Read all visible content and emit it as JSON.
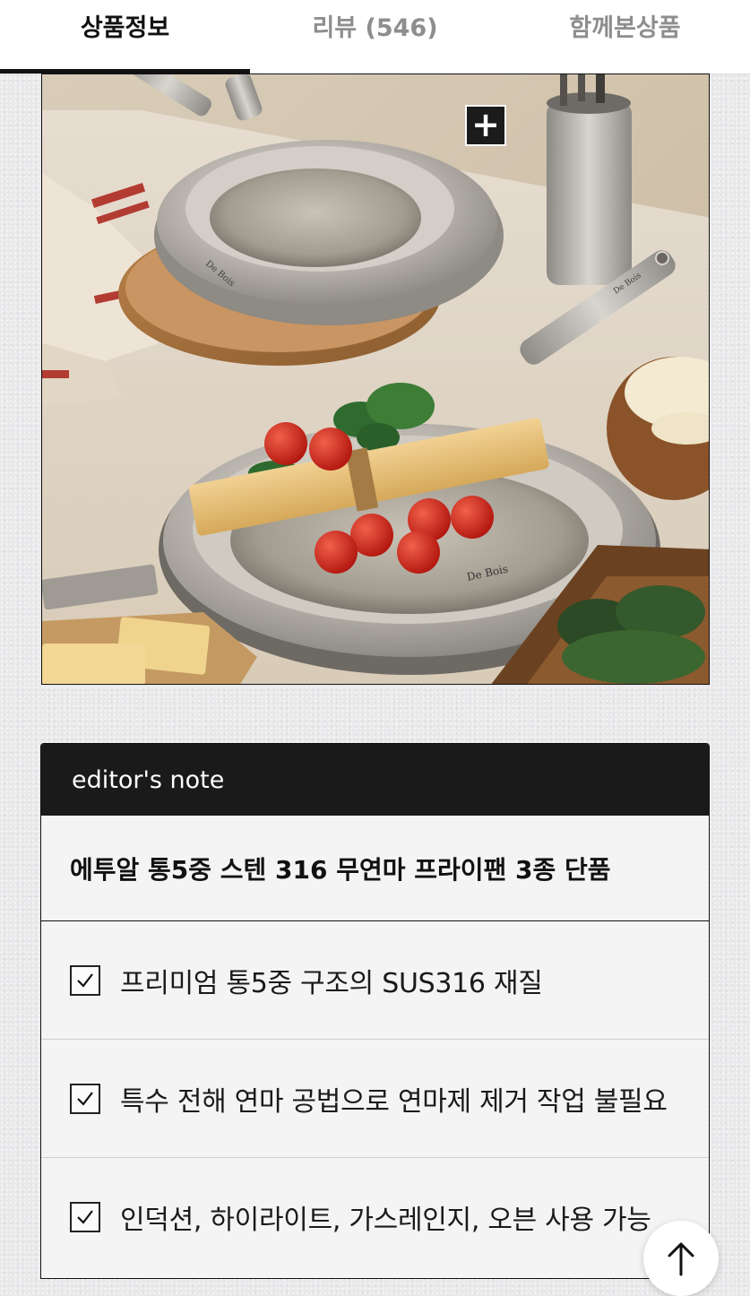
{
  "tabs": [
    {
      "label": "상품정보",
      "active": true
    },
    {
      "label": "리뷰 (546)",
      "active": false
    },
    {
      "label": "함께본상품",
      "active": false
    }
  ],
  "photo": {
    "brand_mark": "De Bois",
    "zoom_icon": "plus-icon"
  },
  "editors_note": {
    "header": "editor's note",
    "title": "에투알 통5중 스텐 316 무연마 프라이팬 3종 단품",
    "items": [
      {
        "icon": "checkbox-checked-icon",
        "text": "프리미엄 통5중 구조의 SUS316 재질"
      },
      {
        "icon": "checkbox-checked-icon",
        "text": "특수 전해 연마 공법으로 연마제 제거 작업 불필요"
      },
      {
        "icon": "checkbox-checked-icon",
        "text": "인덕션, 하이라이트, 가스레인지, 오븐 사용 가능"
      }
    ]
  },
  "scroll_top": {
    "icon": "arrow-up-icon"
  },
  "colors": {
    "active_tab": "#111111",
    "inactive_tab": "#8e8e8e",
    "note_header_bg": "#1a1a1a",
    "page_bg": "#e9e9eb"
  }
}
